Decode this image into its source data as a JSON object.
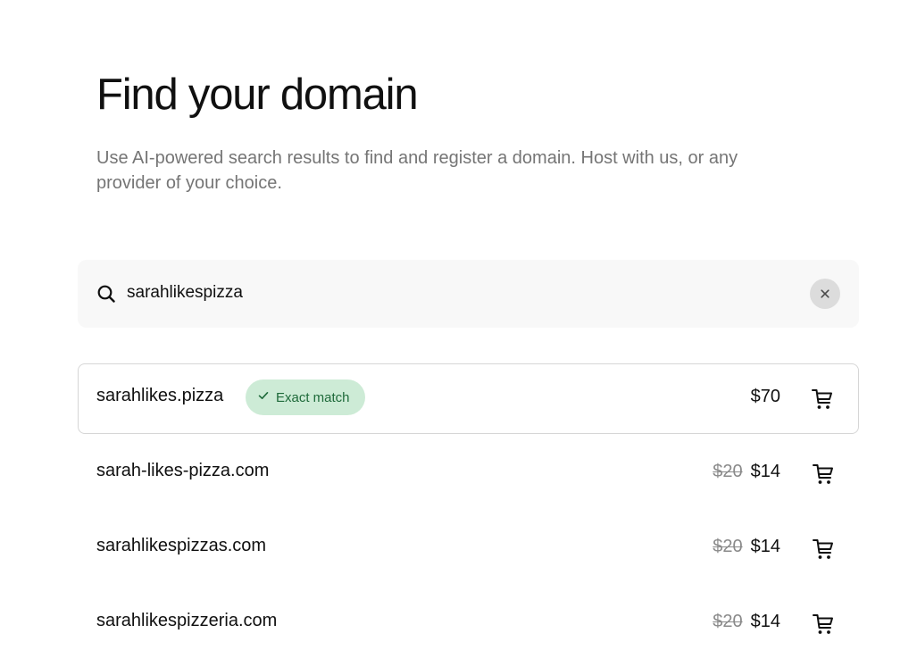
{
  "header": {
    "title": "Find your domain",
    "subtitle": "Use AI-powered search results to find and register a domain. Host with us, or any provider of your choice."
  },
  "search": {
    "value": "sarahlikespizza",
    "search_icon": "search-icon",
    "clear_icon": "close-icon"
  },
  "results": [
    {
      "domain": "sarahlikes.pizza",
      "badge": "Exact match",
      "old_price": "",
      "price": "$70",
      "cart_icon": "cart-icon"
    },
    {
      "domain": "sarah-likes-pizza.com",
      "old_price": "$20",
      "price": "$14",
      "cart_icon": "cart-icon"
    },
    {
      "domain": "sarahlikespizzas.com",
      "old_price": "$20",
      "price": "$14",
      "cart_icon": "cart-icon"
    },
    {
      "domain": "sarahlikespizzeria.com",
      "old_price": "$20",
      "price": "$14",
      "cart_icon": "cart-icon"
    }
  ],
  "colors": {
    "badge_background": "#cdebd6",
    "badge_text": "#1e6a3a",
    "search_background": "#f8f8f8",
    "subtitle_text": "#757575"
  }
}
